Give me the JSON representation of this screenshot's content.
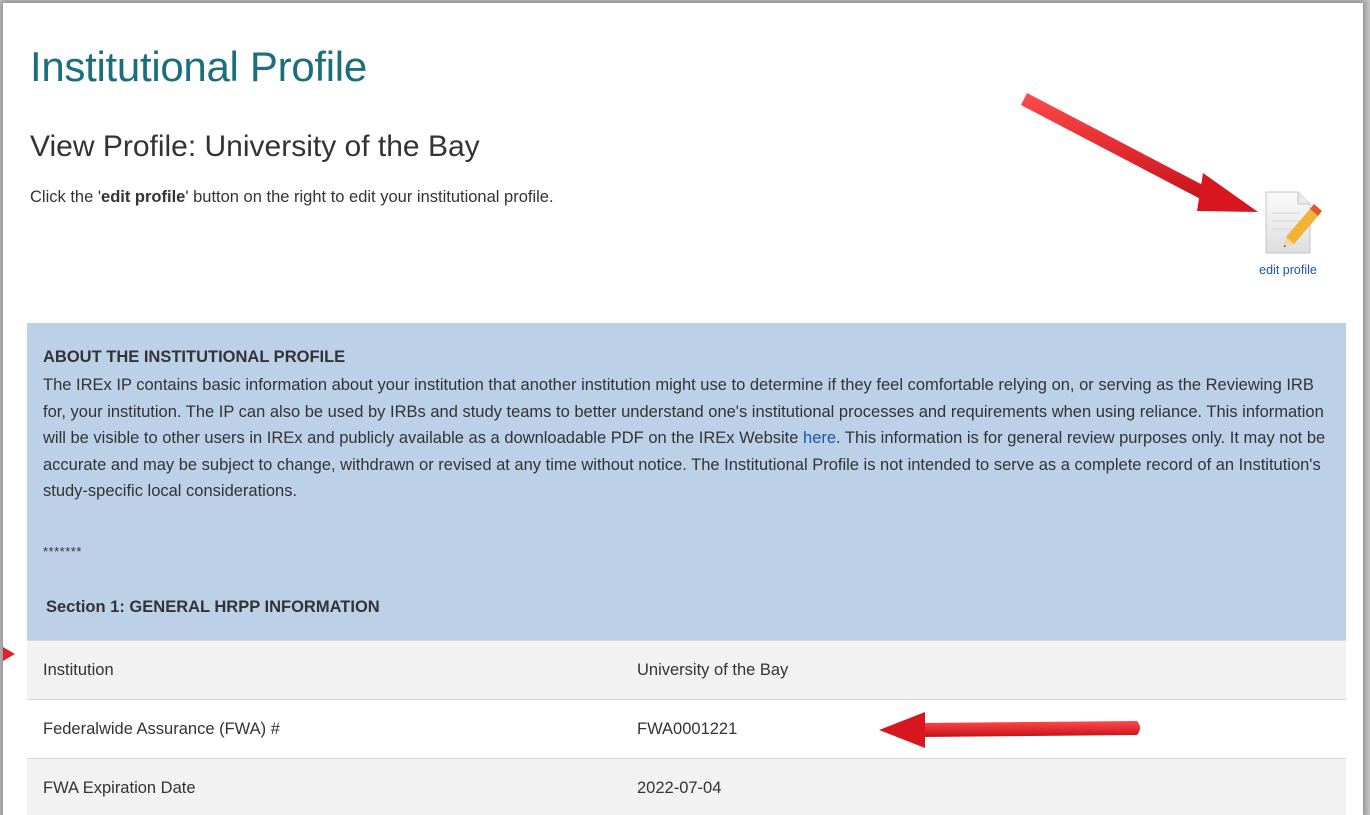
{
  "header": {
    "title": "Institutional Profile",
    "subtitle": "View Profile: University of the Bay"
  },
  "instructions": {
    "prefix": "Click the '",
    "bold": "edit profile",
    "suffix": "' button on the right to edit your institutional profile."
  },
  "edit_button": {
    "label": "edit profile",
    "icon": "edit-document-pencil-icon"
  },
  "about_panel": {
    "title": "ABOUT THE INSTITUTIONAL PROFILE",
    "body_before_link": "The IREx IP contains basic information about your institution that another institution might use to determine if they feel comfortable relying on, or serving as the Reviewing IRB for, your institution. The IP can also be used by IRBs and study teams to better understand one's institutional processes and requirements when using reliance. This information will be visible to other users in IREx and publicly available as a downloadable PDF on the IREx Website ",
    "link_text": "here",
    "body_after_link": ". This information is for general review purposes only. It may not be accurate and may be subject to change, withdrawn or revised at any time without notice. The Institutional Profile is not intended to serve as a complete record of an Institution's study-specific local considerations.",
    "divider": "*******"
  },
  "section": {
    "title": "Section 1: GENERAL HRPP INFORMATION",
    "rows": [
      {
        "label": "Institution",
        "value": "University of the Bay"
      },
      {
        "label": "Federalwide Assurance (FWA) #",
        "value": "FWA0001221"
      },
      {
        "label": "FWA Expiration Date",
        "value": "2022-07-04"
      }
    ]
  },
  "colors": {
    "title_teal": "#1b6e7e",
    "panel_blue": "#bcd0e8",
    "link_blue": "#1a55b0",
    "annotation_red": "#e1202a"
  }
}
